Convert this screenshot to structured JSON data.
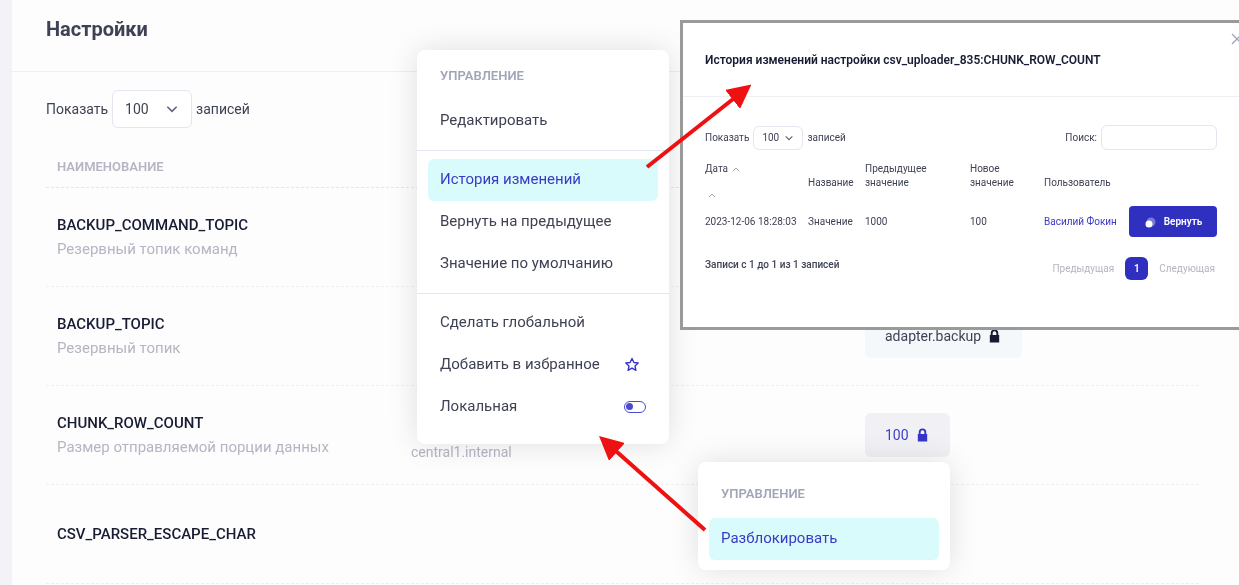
{
  "page_title": "Настройки",
  "show_entries": {
    "label": "Показать",
    "value": "100",
    "suffix": "записей"
  },
  "table": {
    "columns": [
      "НАИМЕНОВАНИЕ"
    ],
    "rows": [
      {
        "name": "BACKUP_COMMAND_TOPIC",
        "description": "Резервный топик команд"
      },
      {
        "name": "BACKUP_TOPIC",
        "description": "Резервный топик",
        "value": {
          "text": "adapter.backup",
          "active": false,
          "locked": true
        }
      },
      {
        "name": "CHUNK_ROW_COUNT",
        "description": "Размер отправляемой порции данных",
        "behind_text": "central1.internal",
        "value": {
          "text": "100",
          "active": true,
          "locked": true
        }
      },
      {
        "name": "CSV_PARSER_ESCAPE_CHAR"
      }
    ]
  },
  "context_menu": [
    {
      "kind": "header",
      "label": "УПРАВЛЕНИЕ"
    },
    {
      "kind": "item",
      "label": "Редактировать",
      "selected": false
    },
    {
      "kind": "divider"
    },
    {
      "kind": "item",
      "label": "История изменений",
      "selected": true
    },
    {
      "kind": "item",
      "label": "Вернуть на предыдущее",
      "selected": false
    },
    {
      "kind": "item",
      "label": "Значение по умолчанию",
      "selected": false
    },
    {
      "kind": "divider"
    },
    {
      "kind": "item",
      "label": "Сделать глобальной",
      "selected": false
    },
    {
      "kind": "star",
      "label": "Добавить в избранное",
      "selected": false
    },
    {
      "kind": "toggle",
      "label": "Локальная",
      "selected": false,
      "on": false
    }
  ],
  "value_menu": [
    {
      "kind": "header",
      "label": "УПРАВЛЕНИЕ"
    },
    {
      "kind": "item",
      "label": "Разблокировать",
      "selected": true
    }
  ],
  "history_modal": {
    "title": "История изменений настройки csv_uploader_835:CHUNK_ROW_COUNT",
    "show_entries": {
      "label": "Показать",
      "value": "100",
      "suffix": "записей"
    },
    "search_label": "Поиск:",
    "columns": [
      "Дата",
      "Название",
      "Предыдущее значение",
      "Новое значение",
      "Пользователь"
    ],
    "rows": [
      {
        "date": "2023-12-06 18:28:03",
        "name": "Значение",
        "previous": "1000",
        "new": "100",
        "user": "Василий Фокин",
        "action": "Вернуть"
      }
    ],
    "info": "Записи с 1 до 1 из 1 записей",
    "pagination": [
      {
        "label": "Предыдущая",
        "kind": "prev",
        "selected": false
      },
      {
        "label": "1",
        "kind": "page",
        "selected": true
      },
      {
        "label": "Следующая",
        "kind": "next",
        "selected": false
      }
    ]
  }
}
